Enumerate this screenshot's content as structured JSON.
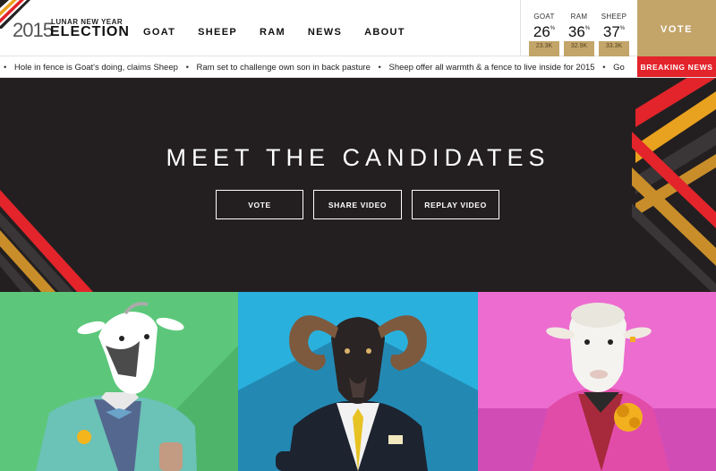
{
  "logo": {
    "year": "2015",
    "subtitle": "LUNAR NEW YEAR",
    "title": "ELECTION"
  },
  "nav": {
    "items": [
      "GOAT",
      "SHEEP",
      "RAM",
      "NEWS",
      "ABOUT"
    ]
  },
  "polls": [
    {
      "name": "GOAT",
      "percent": "26",
      "count": "23.3K"
    },
    {
      "name": "RAM",
      "percent": "36",
      "count": "32.9K"
    },
    {
      "name": "SHEEP",
      "percent": "37",
      "count": "33.3K"
    }
  ],
  "percent_sign": "%",
  "vote_button": "VOTE",
  "ticker": {
    "items": [
      "Hole in fence is Goat's doing, claims Sheep",
      "Ram set to challenge own son in back pasture",
      "Sheep offer all warmth & a fence to live inside for 2015",
      "Go"
    ],
    "separator": "•",
    "breaking_label": "BREAKING NEWS"
  },
  "hero": {
    "title": "MEET THE CANDIDATES",
    "buttons": [
      "VOTE",
      "SHARE VIDEO",
      "REPLAY VIDEO"
    ]
  },
  "colors": {
    "gold": "#c3a56a",
    "red": "#e3242b",
    "hero_bg": "#231f20",
    "goat_bg": "#5cc77a",
    "ram_bg": "#29a6d2",
    "sheep_bg": "#e356c6",
    "stripe_orange": "#e9a21f",
    "stripe_gold": "#c98e2a",
    "stripe_dark": "#3a3536"
  },
  "candidates": [
    {
      "id": "goat",
      "icon": "goat-portrait"
    },
    {
      "id": "ram",
      "icon": "ram-portrait"
    },
    {
      "id": "sheep",
      "icon": "sheep-portrait"
    }
  ]
}
